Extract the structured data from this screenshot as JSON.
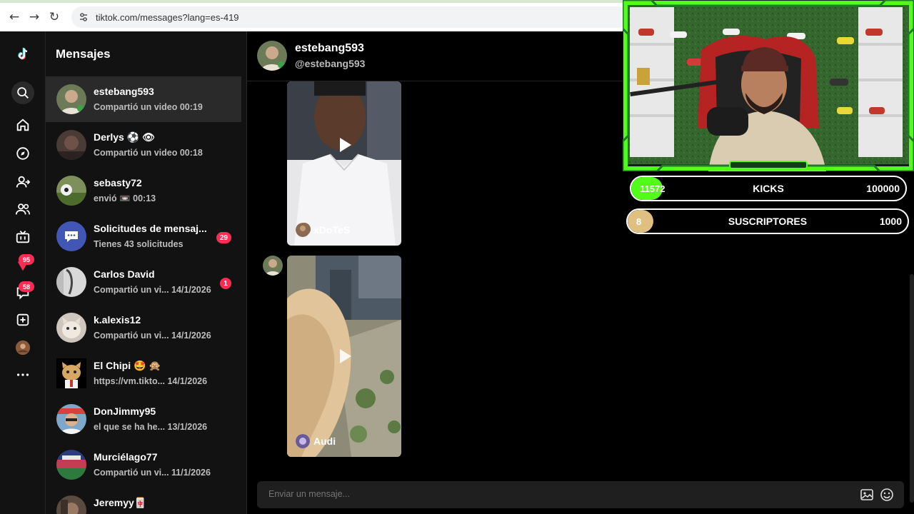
{
  "browser": {
    "url": "tiktok.com/messages?lang=es-419"
  },
  "rail": {
    "badges": {
      "likes": "95",
      "inbox": "58"
    }
  },
  "conversations": {
    "title": "Mensajes",
    "items": [
      {
        "name": "estebang593",
        "snippet": "Compartió un video 00:19",
        "badge": ""
      },
      {
        "name": "Derlys ⚽ 👁",
        "snippet": "Compartió un video 00:18",
        "badge": ""
      },
      {
        "name": "sebasty72",
        "snippet": "envió 📼 00:13",
        "badge": ""
      },
      {
        "name": "Solicitudes de mensaj...",
        "snippet": "Tienes 43 solicitudes",
        "badge": "29"
      },
      {
        "name": "Carlos David",
        "snippet": "Compartió un vi... 14/1/2026",
        "badge": "1"
      },
      {
        "name": "k.alexis12",
        "snippet": "Compartió un vi... 14/1/2026",
        "badge": ""
      },
      {
        "name": "El Chipi 🤩 🙊",
        "snippet": "https://vm.tikto... 14/1/2026",
        "badge": ""
      },
      {
        "name": "DonJimmy95",
        "snippet": "el que se ha he... 13/1/2026",
        "badge": ""
      },
      {
        "name": "Murciélago77",
        "snippet": "Compartió un vi... 11/1/2026",
        "badge": ""
      },
      {
        "name": "Jeremyy🀄",
        "snippet": "",
        "badge": ""
      }
    ]
  },
  "chat": {
    "name": "estebang593",
    "handle": "@estebang593",
    "videos": [
      {
        "author": "xDoTeS"
      },
      {
        "author": "Audi"
      }
    ],
    "composer_placeholder": "Enviar un mensaje..."
  },
  "overlay": {
    "kicks": {
      "value": "11572",
      "label": "KICKS",
      "goal": "100000",
      "progress": 0.1157
    },
    "subs": {
      "value": "8",
      "label": "SUSCRIPTORES",
      "goal": "1000",
      "progress": 0.008
    }
  },
  "colors": {
    "accent": "#fe2c55",
    "kicks_fill": "#53fc18",
    "subs_fill": "#e0c080"
  }
}
